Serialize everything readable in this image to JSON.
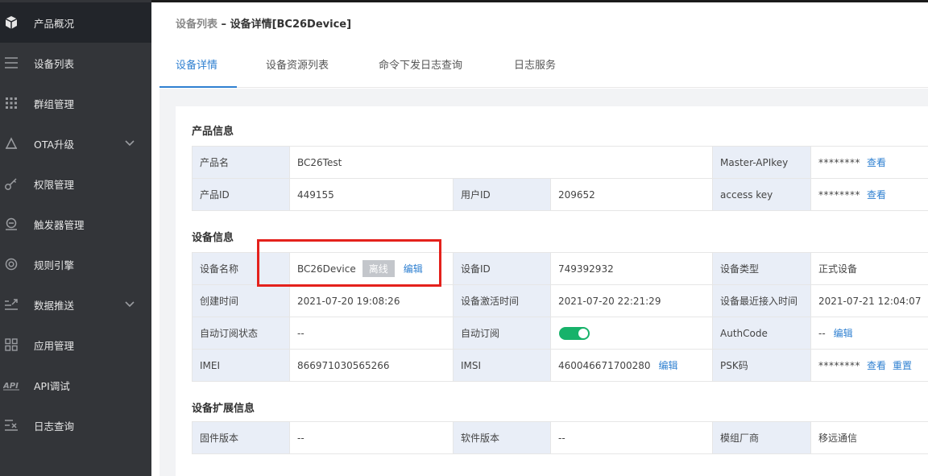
{
  "sidebar": {
    "items": [
      {
        "label": "产品概况",
        "icon": "cube-icon",
        "active": true
      },
      {
        "label": "设备列表",
        "icon": "list-icon"
      },
      {
        "label": "群组管理",
        "icon": "grid-dots-icon"
      },
      {
        "label": "OTA升级",
        "icon": "ota-icon",
        "has_submenu": true
      },
      {
        "label": "权限管理",
        "icon": "key-icon"
      },
      {
        "label": "触发器管理",
        "icon": "trigger-icon"
      },
      {
        "label": "规则引擎",
        "icon": "rule-engine-icon"
      },
      {
        "label": "数据推送",
        "icon": "data-push-icon",
        "has_submenu": true
      },
      {
        "label": "应用管理",
        "icon": "apps-icon"
      },
      {
        "label": "API调试",
        "icon": "api-icon"
      },
      {
        "label": "日志查询",
        "icon": "log-icon"
      }
    ]
  },
  "breadcrumb": {
    "parent": "设备列表",
    "separator": " – ",
    "current": "设备详情[BC26Device]"
  },
  "tabs": [
    {
      "label": "设备详情",
      "active": true
    },
    {
      "label": "设备资源列表"
    },
    {
      "label": "命令下发日志查询"
    },
    {
      "label": "日志服务"
    }
  ],
  "product_info": {
    "title": "产品信息",
    "product_name_label": "产品名",
    "product_name": "BC26Test",
    "master_apikey_label": "Master-APIkey",
    "master_apikey": "********",
    "master_apikey_view": "查看",
    "product_id_label": "产品ID",
    "product_id": "449155",
    "user_id_label": "用户ID",
    "user_id": "209652",
    "access_key_label": "access key",
    "access_key": "********",
    "access_key_view": "查看"
  },
  "device_info": {
    "title": "设备信息",
    "device_name_label": "设备名称",
    "device_name": "BC26Device",
    "status_badge": "离线",
    "device_name_edit": "编辑",
    "device_id_label": "设备ID",
    "device_id": "749392932",
    "device_type_label": "设备类型",
    "device_type": "正式设备",
    "created_label": "创建时间",
    "created": "2021-07-20 19:08:26",
    "activated_label": "设备激活时间",
    "activated": "2021-07-20 22:21:29",
    "last_access_label": "设备最近接入时间",
    "last_access": "2021-07-21 12:04:07",
    "auto_sub_status_label": "自动订阅状态",
    "auto_sub_status": "--",
    "auto_sub_label": "自动订阅",
    "auto_sub_enabled": true,
    "authcode_label": "AuthCode",
    "authcode": "--",
    "authcode_edit": "编辑",
    "imei_label": "IMEI",
    "imei": "866971030565266",
    "imsi_label": "IMSI",
    "imsi": "460046671700280",
    "imsi_edit": "编辑",
    "psk_label": "PSK码",
    "psk": "********",
    "psk_view": "查看",
    "psk_reset": "重置"
  },
  "ext_info": {
    "title": "设备扩展信息",
    "firmware_label": "固件版本",
    "firmware": "--",
    "software_label": "软件版本",
    "software": "--",
    "module_vendor_label": "模组厂商",
    "module_vendor": "移远通信"
  },
  "colors": {
    "sidebar_bg": "#333539",
    "sidebar_active": "#22252a",
    "accent": "#2f80d1",
    "key_cell_bg": "#e9eef7",
    "toggle_on": "#17b26a",
    "highlight": "#e4211c"
  }
}
